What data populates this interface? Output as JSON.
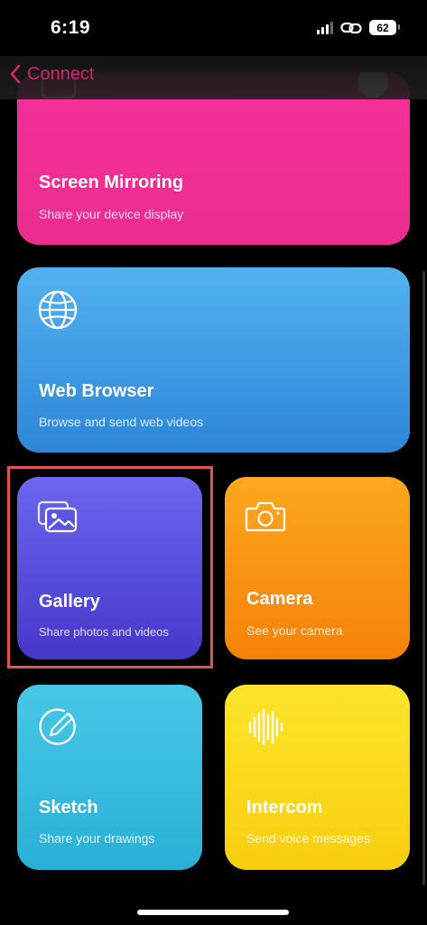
{
  "status": {
    "time": "6:19",
    "battery": "62",
    "icons": [
      "signal-icon",
      "link-icon",
      "battery-icon"
    ]
  },
  "nav": {
    "back_label": "Connect",
    "accent": "#d4246b"
  },
  "cards": {
    "mirror": {
      "title": "Screen Mirroring",
      "subtitle": "Share your device display",
      "icon": "screen-mirroring-icon",
      "color": "#f72f9a"
    },
    "web": {
      "title": "Web Browser",
      "subtitle": "Browse and send web videos",
      "icon": "globe-icon",
      "color": "#3d9be2"
    },
    "gallery": {
      "title": "Gallery",
      "subtitle": "Share photos and videos",
      "icon": "photos-icon",
      "color": "#5a51de"
    },
    "camera": {
      "title": "Camera",
      "subtitle": "See your camera",
      "icon": "camera-icon",
      "color": "#fa9512"
    },
    "sketch": {
      "title": "Sketch",
      "subtitle": "Share your drawings",
      "icon": "pencil-icon",
      "color": "#38bcde"
    },
    "intercom": {
      "title": "Intercom",
      "subtitle": "Send voice messages",
      "icon": "waveform-icon",
      "color": "#fbd91c"
    }
  },
  "highlight_color": "#e4524f"
}
